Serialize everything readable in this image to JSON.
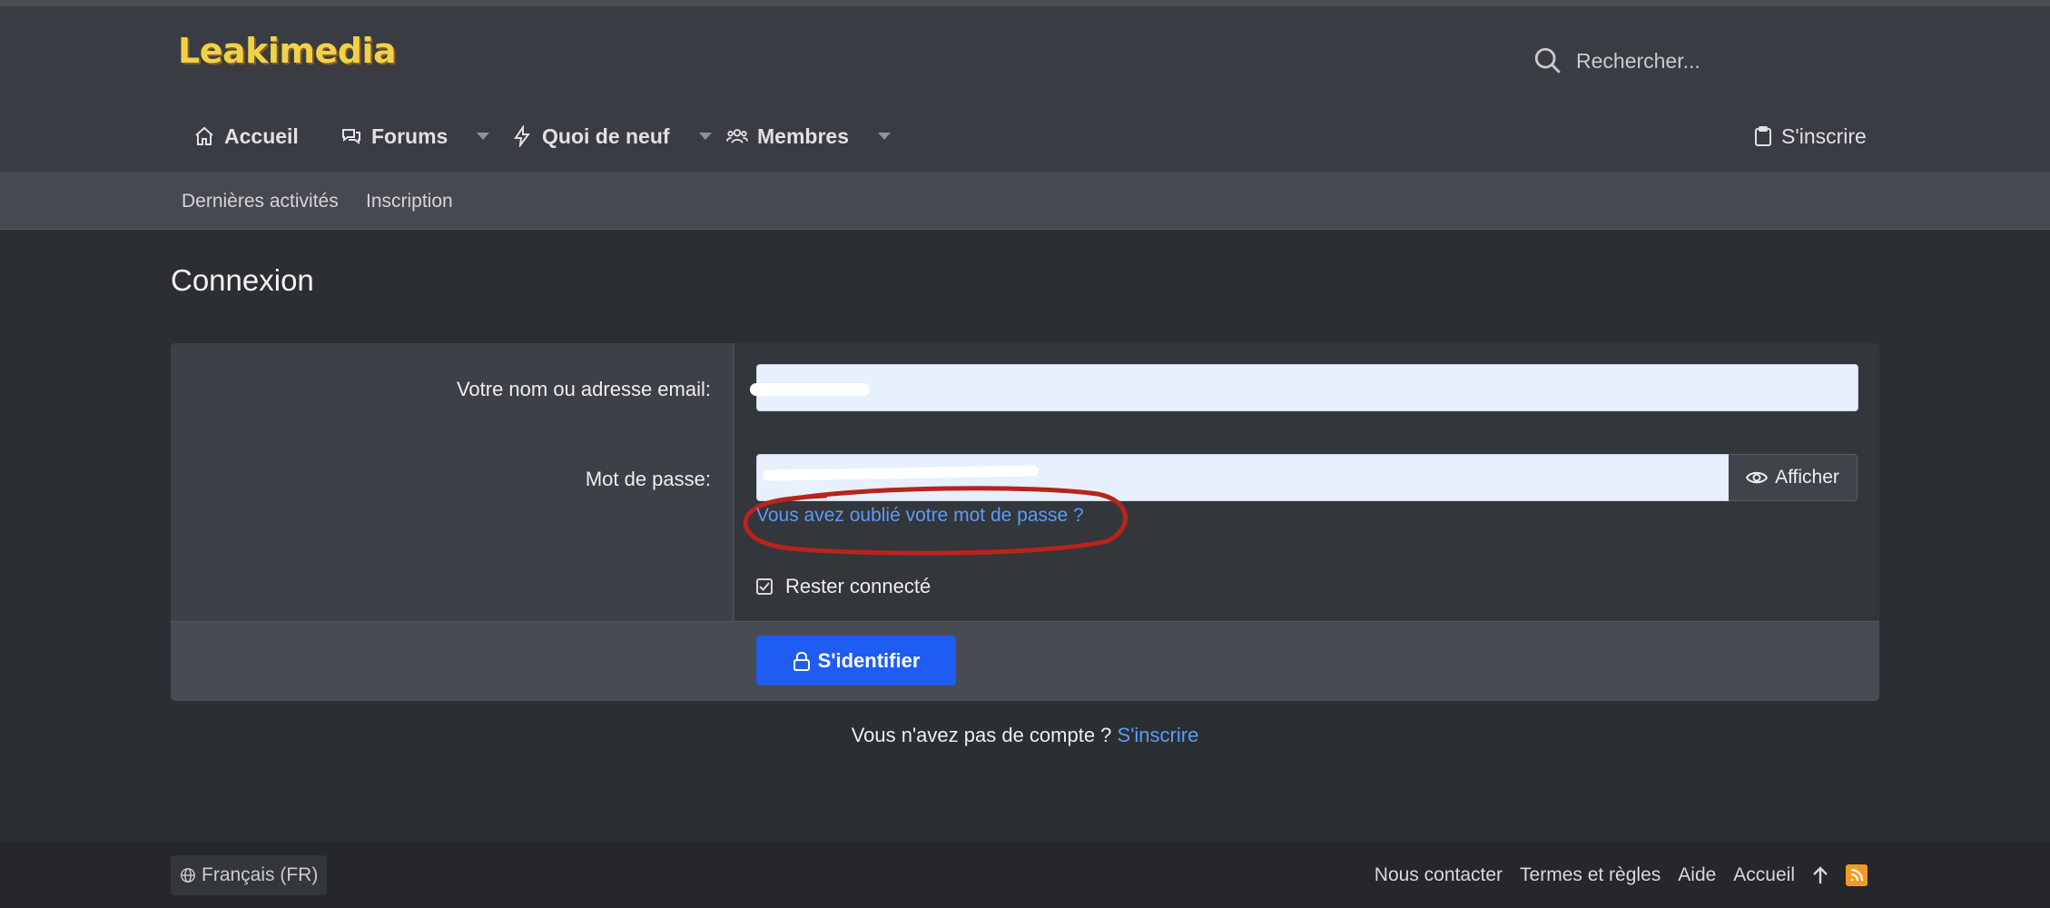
{
  "brand": {
    "logo": "Leakimedia"
  },
  "search": {
    "placeholder": "Rechercher..."
  },
  "nav": {
    "home": "Accueil",
    "forums": "Forums",
    "whats_new": "Quoi de neuf",
    "members": "Membres",
    "register": "S'inscrire"
  },
  "subnav": {
    "recent": "Dernières activités",
    "signup": "Inscription"
  },
  "page": {
    "title": "Connexion"
  },
  "form": {
    "username_label": "Votre nom ou adresse email:",
    "username_value": "",
    "password_label": "Mot de passe:",
    "password_value": "",
    "show_label": "Afficher",
    "forgot_label": "Vous avez oublié votre mot de passe ?",
    "remember_label": "Rester connecté",
    "remember_checked": true,
    "submit_label": "S'identifier"
  },
  "signup_prompt": {
    "text": "Vous n'avez pas de compte ? ",
    "link": "S'inscrire"
  },
  "footer": {
    "language": "Français (FR)",
    "contact": "Nous contacter",
    "terms": "Termes et règles",
    "help": "Aide",
    "home": "Accueil"
  },
  "colors": {
    "accent": "#1e5cf2",
    "link": "#5b9cf6",
    "logo": "#f0d24a",
    "annotation": "#b8241c",
    "rss": "#f49b1f"
  }
}
